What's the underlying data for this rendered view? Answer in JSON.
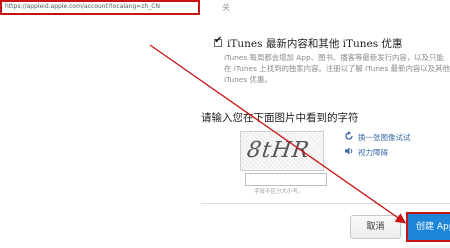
{
  "browser": {
    "url": "https://appleid.apple.com/account?localang=zh_CN"
  },
  "top_fragment": "关",
  "itunes_option": {
    "checked": true,
    "title": "iTunes 最新内容和其他 iTunes 优惠",
    "description": "iTunes 每周都会增加 App、图书、播客等最新发行内容，以及只能在 iTunes 上找到的独家内容。注册以了解 iTunes 最新内容以及其他 iTunes 优惠。"
  },
  "captcha": {
    "heading": "请输入您在下面图片中看到的字符",
    "image_text": "8tHR",
    "input_value": "",
    "hint": "字母不区分大小写。",
    "new_image_link": "换一张图像试试",
    "audio_link": "视力障碍"
  },
  "footer": {
    "cancel_label": "取消",
    "create_label": "创建 App"
  },
  "colors": {
    "annotation": "#c81414",
    "primary_button": "#1e86d9",
    "link": "#3b6aa8"
  }
}
